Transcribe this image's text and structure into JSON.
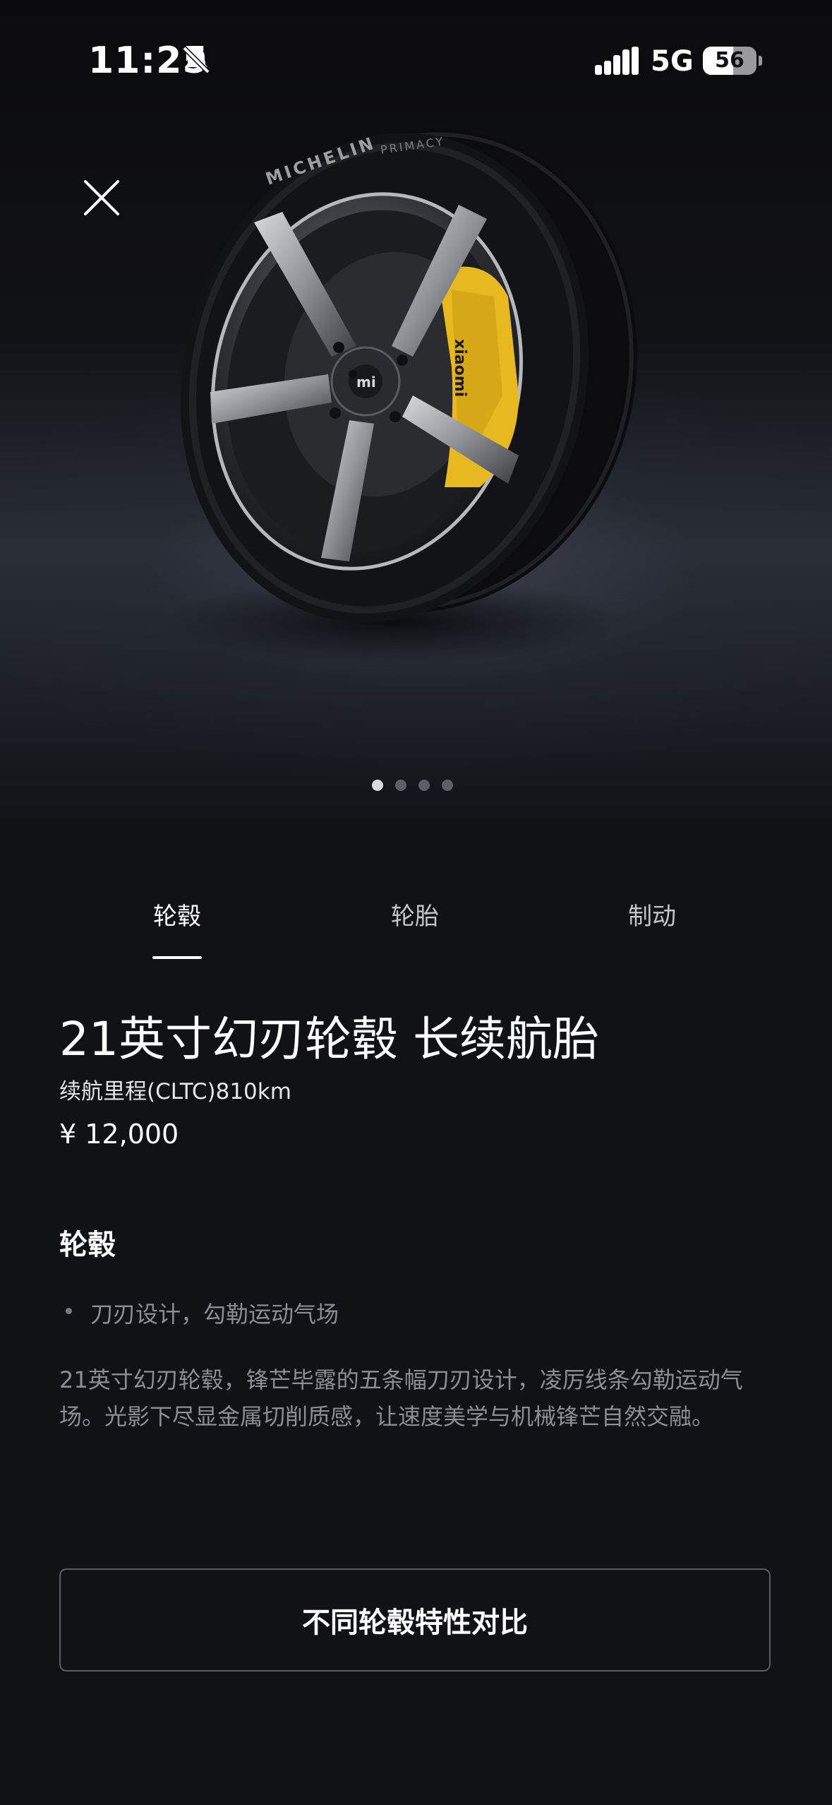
{
  "status_bar": {
    "time": "11:25",
    "network": "5G",
    "battery": 56
  },
  "hero": {
    "close_icon": "close-icon",
    "image_subject": "wheel-image",
    "tire_brand_text": "MICHELIN",
    "tire_model_text": "PRIMACY",
    "logo_text": "mi",
    "caliper_text": "xiaomi",
    "pager": {
      "count": 4,
      "active_index": 0
    }
  },
  "tabs": [
    {
      "label": "轮毂",
      "active": true
    },
    {
      "label": "轮胎",
      "active": false
    },
    {
      "label": "制动",
      "active": false
    }
  ],
  "product": {
    "title": "21英寸幻刃轮毂 长续航胎",
    "range": "续航里程(CLTC)810km",
    "price": "¥ 12,000"
  },
  "section": {
    "heading": "轮毂",
    "bullet": "刀刃设计，勾勒运动气场",
    "description": "21英寸幻刃轮毂，锋芒毕露的五条幅刀刃设计，凌厉线条勾勒运动气场。光影下尽显金属切削质感，让速度美学与机械锋芒自然交融。"
  },
  "compare_button": {
    "label": "不同轮毂特性对比"
  },
  "colors": {
    "background": "#111216",
    "caliper": "#e8b820",
    "text_secondary": "#8c8e94"
  }
}
